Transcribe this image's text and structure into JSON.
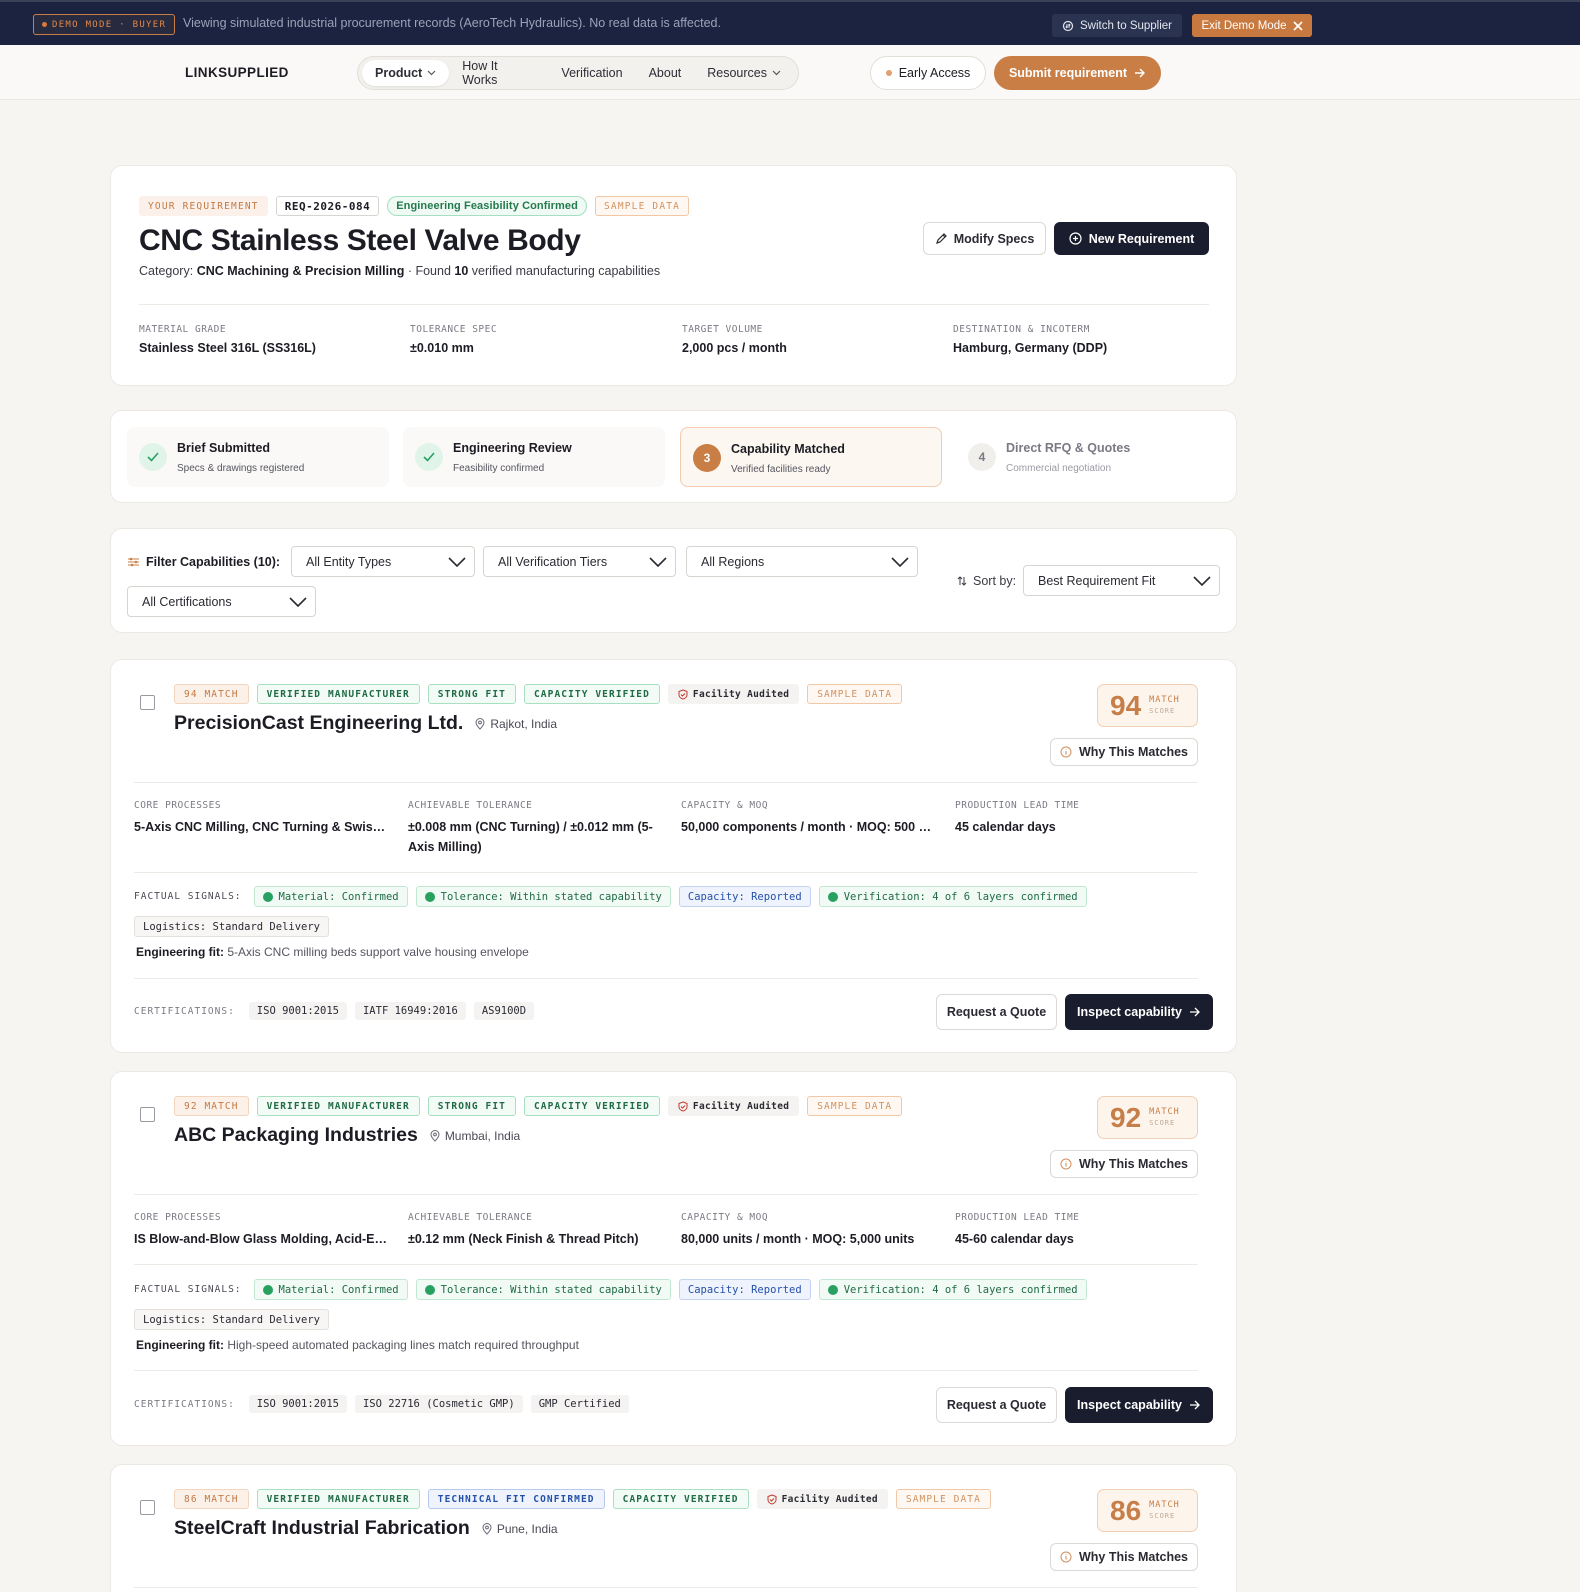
{
  "demo_bar": {
    "badge": "DEMO MODE · BUYER",
    "message": "Viewing simulated industrial procurement records (AeroTech Hydraulics). No real data is affected.",
    "switch_label": "Switch to Supplier",
    "exit_label": "Exit Demo Mode"
  },
  "nav": {
    "brand": "LINKSUPPLIED",
    "items": [
      {
        "label": "Product",
        "dropdown": true,
        "active": true
      },
      {
        "label": "How It Works"
      },
      {
        "label": "Verification"
      },
      {
        "label": "About"
      },
      {
        "label": "Resources",
        "dropdown": true
      }
    ],
    "early_access": "Early Access",
    "submit": "Submit requirement"
  },
  "requirement": {
    "tag_your": "YOUR REQUIREMENT",
    "id": "REQ-2026-084",
    "status": "Engineering Feasibility Confirmed",
    "sample": "SAMPLE DATA",
    "title": "CNC Stainless Steel Valve Body",
    "category_prefix": "Category:",
    "category": "CNC Machining & Precision Milling",
    "found_prefix": "· Found",
    "found_count": "10",
    "found_suffix": "verified manufacturing capabilities",
    "modify": "Modify Specs",
    "new": "New Requirement",
    "specs": [
      {
        "label": "MATERIAL GRADE",
        "value": "Stainless Steel 316L (SS316L)"
      },
      {
        "label": "TOLERANCE SPEC",
        "value": "±0.010 mm"
      },
      {
        "label": "TARGET VOLUME",
        "value": "2,000 pcs / month"
      },
      {
        "label": "DESTINATION & INCOTERM",
        "value": "Hamburg, Germany (DDP)"
      }
    ]
  },
  "steps": [
    {
      "title": "Brief Submitted",
      "sub": "Specs & drawings registered",
      "state": "done"
    },
    {
      "title": "Engineering Review",
      "sub": "Feasibility confirmed",
      "state": "done"
    },
    {
      "num": "3",
      "title": "Capability Matched",
      "sub": "Verified facilities ready",
      "state": "current"
    },
    {
      "num": "4",
      "title": "Direct RFQ & Quotes",
      "sub": "Commercial negotiation",
      "state": "pending"
    }
  ],
  "filters": {
    "label": "Filter Capabilities (10):",
    "entity": "All Entity Types",
    "tiers": "All Verification Tiers",
    "regions": "All Regions",
    "certs": "All Certifications",
    "sort_label": "Sort by:",
    "sort": "Best Requirement Fit"
  },
  "suppliers": [
    {
      "match_tag": "94 MATCH",
      "badges": [
        "VERIFIED MANUFACTURER",
        "STRONG FIT",
        "CAPACITY VERIFIED"
      ],
      "audit": "Facility Audited",
      "sample": "SAMPLE DATA",
      "name": "PrecisionCast Engineering Ltd.",
      "location": "Rajkot, India",
      "score": "94",
      "score_label": "MATCH",
      "score_sub": "SCORE",
      "why": "Why This Matches",
      "cols": [
        {
          "label": "CORE PROCESSES",
          "value": "5-Axis CNC Milling, CNC Turning & Swiss M..."
        },
        {
          "label": "ACHIEVABLE TOLERANCE",
          "value": "±0.008 mm (CNC Turning) / ±0.012 mm (5-Axis Milling)"
        },
        {
          "label": "CAPACITY & MOQ",
          "value": "50,000 components / month · MOQ: 500 u..."
        },
        {
          "label": "PRODUCTION LEAD TIME",
          "value": "45 calendar days"
        }
      ],
      "signals_label": "FACTUAL SIGNALS:",
      "signals": [
        "Material: Confirmed",
        "Tolerance: Within stated capability",
        "Capacity: Reported",
        "Verification: 4 of 6 layers confirmed",
        "Logistics: Standard Delivery"
      ],
      "eng_label": "Engineering fit:",
      "eng": "5-Axis CNC milling beds support valve housing envelope",
      "cert_label": "CERTIFICATIONS:",
      "certs": [
        "ISO 9001:2015",
        "IATF 16949:2016",
        "AS9100D"
      ],
      "quote": "Request a Quote",
      "inspect": "Inspect capability"
    },
    {
      "match_tag": "92 MATCH",
      "badges": [
        "VERIFIED MANUFACTURER",
        "STRONG FIT",
        "CAPACITY VERIFIED"
      ],
      "audit": "Facility Audited",
      "sample": "SAMPLE DATA",
      "name": "ABC Packaging Industries",
      "location": "Mumbai, India",
      "score": "92",
      "score_label": "MATCH",
      "score_sub": "SCORE",
      "why": "Why This Matches",
      "cols": [
        {
          "label": "CORE PROCESSES",
          "value": "IS Blow-and-Blow Glass Molding, Acid-Etch..."
        },
        {
          "label": "ACHIEVABLE TOLERANCE",
          "value": "±0.12 mm (Neck Finish & Thread Pitch)"
        },
        {
          "label": "CAPACITY & MOQ",
          "value": "80,000 units / month · MOQ: 5,000 units"
        },
        {
          "label": "PRODUCTION LEAD TIME",
          "value": "45-60 calendar days"
        }
      ],
      "signals_label": "FACTUAL SIGNALS:",
      "signals": [
        "Material: Confirmed",
        "Tolerance: Within stated capability",
        "Capacity: Reported",
        "Verification: 4 of 6 layers confirmed",
        "Logistics: Standard Delivery"
      ],
      "eng_label": "Engineering fit:",
      "eng": "High-speed automated packaging lines match required throughput",
      "cert_label": "CERTIFICATIONS:",
      "certs": [
        "ISO 9001:2015",
        "ISO 22716 (Cosmetic GMP)",
        "GMP Certified"
      ],
      "quote": "Request a Quote",
      "inspect": "Inspect capability"
    },
    {
      "match_tag": "86 MATCH",
      "badges": [
        "VERIFIED MANUFACTURER",
        "TECHNICAL FIT CONFIRMED",
        "CAPACITY VERIFIED"
      ],
      "audit": "Facility Audited",
      "sample": "SAMPLE DATA",
      "name": "SteelCraft Industrial Fabrication",
      "location": "Pune, India",
      "score": "86",
      "score_label": "MATCH",
      "score_sub": "SCORE",
      "why": "Why This Matches"
    }
  ]
}
